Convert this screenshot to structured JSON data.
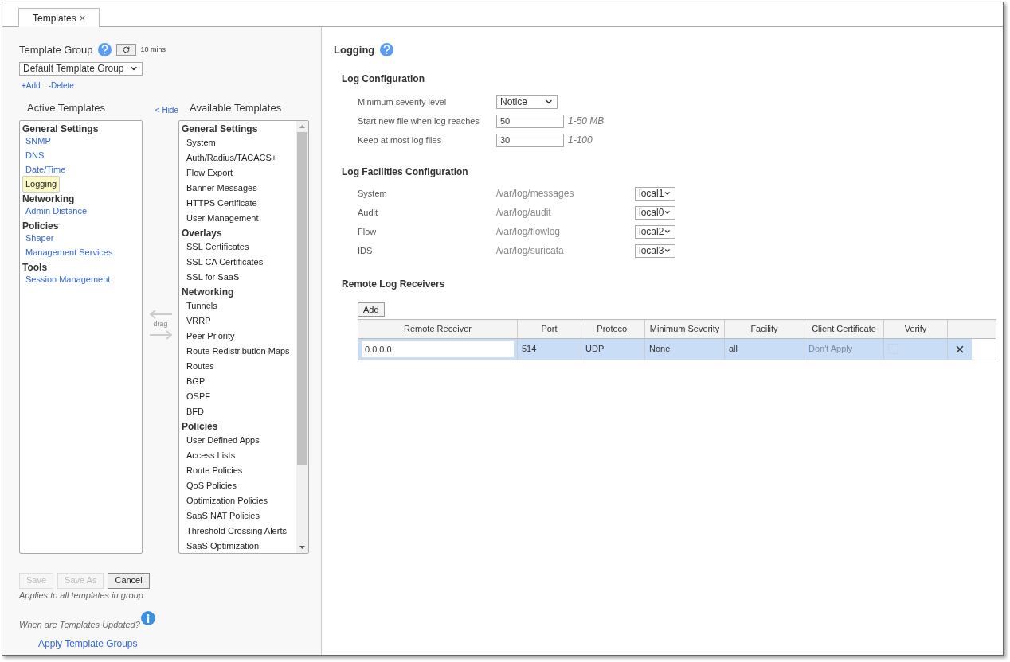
{
  "tab": {
    "label": "Templates",
    "close": "×"
  },
  "left": {
    "title": "Template Group",
    "refresh_interval": "10 mins",
    "group_select": "Default Template Group",
    "links": [
      "+Add",
      "-Delete"
    ],
    "active_title": "Active Templates",
    "hide_link": "< Hide",
    "available_title": "Available Templates",
    "drag_label": "drag",
    "active_templates": [
      {
        "label": "General Settings",
        "children": [
          {
            "label": "SNMP",
            "selected": false
          },
          {
            "label": "DNS",
            "selected": false
          },
          {
            "label": "Date/Time",
            "selected": false
          },
          {
            "label": "Logging",
            "selected": true
          }
        ]
      },
      {
        "label": "Networking",
        "children": [
          {
            "label": "Admin Distance",
            "selected": false
          }
        ]
      },
      {
        "label": "Policies",
        "children": [
          {
            "label": "Shaper",
            "selected": false
          },
          {
            "label": "Management Services",
            "selected": false
          }
        ]
      },
      {
        "label": "Tools",
        "children": [
          {
            "label": "Session Management",
            "selected": false
          }
        ]
      }
    ],
    "available_templates": [
      {
        "label": "General Settings",
        "children": [
          "System",
          "Auth/Radius/TACACS+",
          "Flow Export",
          "Banner Messages",
          "HTTPS Certificate",
          "User Management"
        ]
      },
      {
        "label": "Overlays",
        "children": [
          "SSL Certificates",
          "SSL CA Certificates",
          "SSL for SaaS"
        ]
      },
      {
        "label": "Networking",
        "children": [
          "Tunnels",
          "VRRP",
          "Peer Priority",
          "Route Redistribution Maps",
          "Routes",
          "BGP",
          "OSPF",
          "BFD"
        ]
      },
      {
        "label": "Policies",
        "children": [
          "User Defined Apps",
          "Access Lists",
          "Route Policies",
          "QoS Policies",
          "Optimization Policies",
          "SaaS NAT Policies",
          "Threshold Crossing Alerts",
          "SaaS Optimization"
        ]
      }
    ],
    "buttons": [
      {
        "label": "Save",
        "disabled": true
      },
      {
        "label": "Save As",
        "disabled": true
      },
      {
        "label": "Cancel",
        "disabled": false
      }
    ],
    "note": "Applies to all templates in group",
    "updated_question": "When are Templates Updated?",
    "apply_link": "Apply Template Groups"
  },
  "right": {
    "title": "Logging",
    "log_config": {
      "title": "Log Configuration",
      "rows": [
        {
          "kind": "select",
          "label": "Minimum severity level",
          "value": "Notice"
        },
        {
          "kind": "input",
          "label": "Start new file when log reaches",
          "value": "50",
          "hint": "1-50 MB"
        },
        {
          "kind": "input",
          "label": "Keep at most log files",
          "value": "30",
          "hint": "1-100"
        }
      ]
    },
    "facilities": {
      "title": "Log Facilities Configuration",
      "rows": [
        {
          "name": "System",
          "path": "/var/log/messages",
          "facility": "local1"
        },
        {
          "name": "Audit",
          "path": "/var/log/audit",
          "facility": "local0"
        },
        {
          "name": "Flow",
          "path": "/var/log/flowlog",
          "facility": "local2"
        },
        {
          "name": "IDS",
          "path": "/var/log/suricata",
          "facility": "local3"
        }
      ]
    },
    "receivers": {
      "title": "Remote Log Receivers",
      "add_button": "Add",
      "columns": [
        "Remote Receiver",
        "Port",
        "Protocol",
        "Minimum Severity",
        "Facility",
        "Client Certificate",
        "Verify"
      ],
      "rows": [
        {
          "selected": true,
          "receiver": "0.0.0.0",
          "port": "514",
          "protocol": "UDP",
          "severity": "None",
          "facility": "all",
          "certificate": {
            "text": "Don't Apply",
            "disabled": true
          },
          "verify": {
            "checked": false,
            "disabled": true
          }
        }
      ]
    }
  }
}
